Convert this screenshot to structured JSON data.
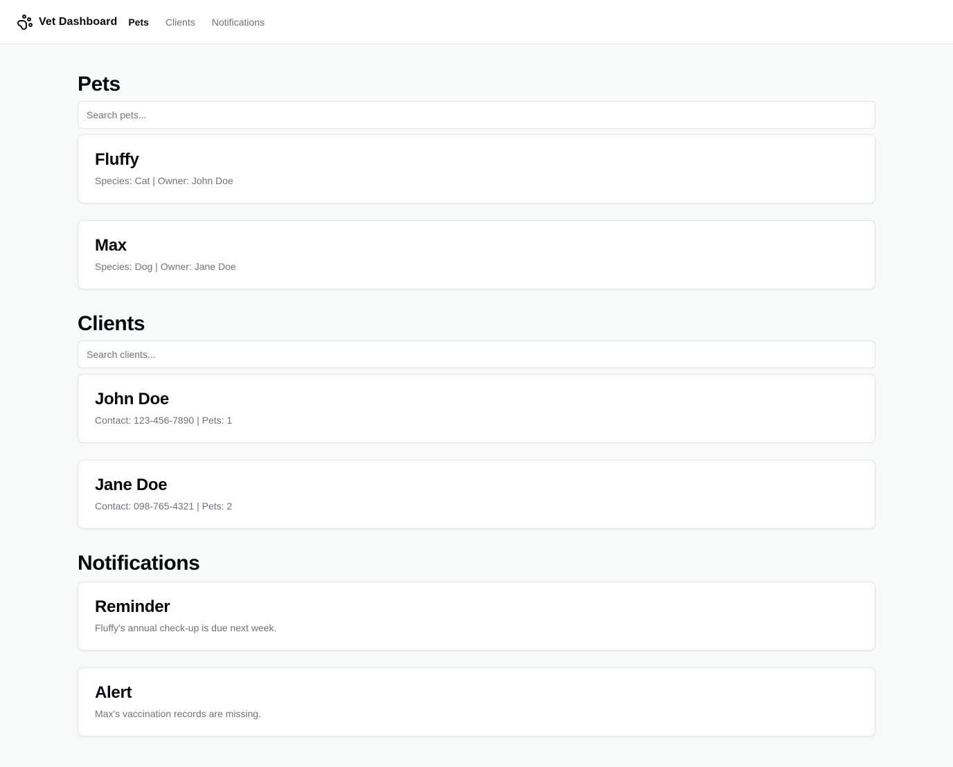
{
  "header": {
    "brand": "Vet Dashboard",
    "brand_icon": "paw-icon",
    "nav": [
      {
        "label": "Pets",
        "active": true
      },
      {
        "label": "Clients",
        "active": false
      },
      {
        "label": "Notifications",
        "active": false
      }
    ]
  },
  "pets": {
    "title": "Pets",
    "search_placeholder": "Search pets...",
    "items": [
      {
        "name": "Fluffy",
        "species_label": "Species: Cat",
        "owner_label": "Owner: John Doe"
      },
      {
        "name": "Max",
        "species_label": "Species: Dog",
        "owner_label": "Owner: Jane Doe"
      }
    ]
  },
  "clients": {
    "title": "Clients",
    "search_placeholder": "Search clients...",
    "items": [
      {
        "name": "John Doe",
        "contact_label": "Contact: 123-456-7890",
        "pets_label": "Pets: 1"
      },
      {
        "name": "Jane Doe",
        "contact_label": "Contact: 098-765-4321",
        "pets_label": "Pets: 2"
      }
    ]
  },
  "notifications": {
    "title": "Notifications",
    "items": [
      {
        "title": "Reminder",
        "message": "Fluffy's annual check-up is due next week."
      },
      {
        "title": "Alert",
        "message": "Max's vaccination records are missing."
      }
    ]
  },
  "separator": "|",
  "colors": {
    "background": "#f8f9f9",
    "card": "#ffffff",
    "border": "#e4e4e7",
    "text": "#09090b",
    "muted": "#71717a"
  }
}
